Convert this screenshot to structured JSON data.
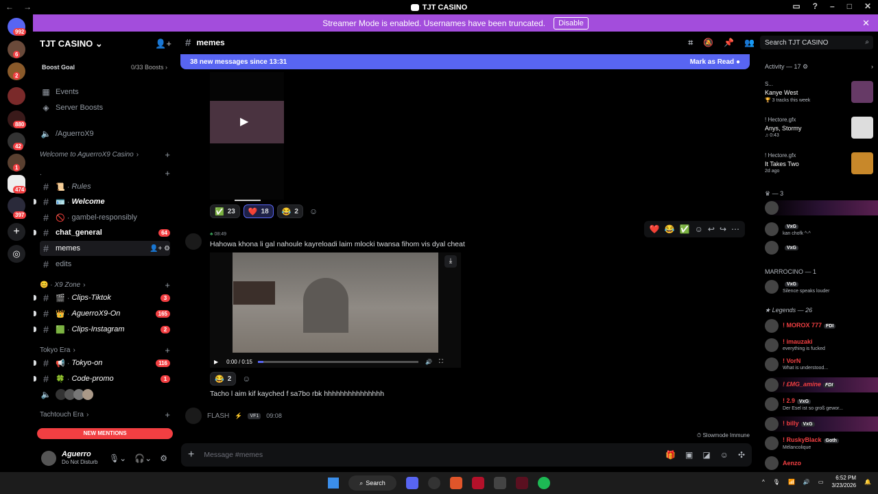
{
  "window": {
    "title": "TJT CASINO"
  },
  "banner": {
    "text": "Streamer Mode is enabled. Usernames have been truncated.",
    "button": "Disable"
  },
  "guild_badges": [
    "992",
    "6",
    "2",
    "880",
    "42",
    "1",
    "474",
    "397"
  ],
  "server": {
    "name": "TJT CASINO",
    "boost_goal": "Boost Goal",
    "boost_count": "0/33 Boosts",
    "items": [
      {
        "type": "nav",
        "icon": "calendar-icon",
        "label": "Events"
      },
      {
        "type": "nav",
        "icon": "boost-icon",
        "label": "Server Boosts"
      },
      {
        "type": "voice",
        "label": "/AguerroX9"
      },
      {
        "type": "category",
        "label": "Welcome to AguerroX9 Casino"
      },
      {
        "type": "category",
        "label": "."
      },
      {
        "type": "channel",
        "label": "Rules",
        "prefix": "📜 ·"
      },
      {
        "type": "channel",
        "label": "Welcome",
        "prefix": "🪪 ·",
        "unread": true
      },
      {
        "type": "channel",
        "label": "gambel-responsibly",
        "prefix": "🚫 ·"
      },
      {
        "type": "channel",
        "label": "chat_general",
        "badge": "64",
        "unread": true
      },
      {
        "type": "channel",
        "label": "memes",
        "active": true
      },
      {
        "type": "channel",
        "label": "edits"
      },
      {
        "type": "category",
        "label": "X9 Zone"
      },
      {
        "type": "channel",
        "label": "Clips-Tiktok",
        "prefix": "🎬 ·",
        "badge": "3",
        "unread": true
      },
      {
        "type": "channel",
        "label": "AguerroX9-On",
        "prefix": "👑 ·",
        "badge": "165",
        "unread": true
      },
      {
        "type": "channel",
        "label": "Clips-Instagram",
        "prefix": "🟩 ·",
        "badge": "2",
        "unread": true
      },
      {
        "type": "category",
        "label": "Tokyo Era"
      },
      {
        "type": "channel",
        "label": "Tokyo-on",
        "prefix": "📢 ·",
        "badge": "116",
        "unread": true
      },
      {
        "type": "channel",
        "label": "Code-promo",
        "prefix": "🍀 ·",
        "badge": "1",
        "unread": true
      },
      {
        "type": "category",
        "label": "Tachtouch Era"
      }
    ],
    "new_mentions": "NEW MENTIONS"
  },
  "user": {
    "name": "Aguerro",
    "status": "Do Not Disturb"
  },
  "chat": {
    "channel": "memes",
    "new_messages": "38 new messages since 13:31",
    "mark_read": "Mark as Read",
    "reactions1": [
      {
        "emoji": "✅",
        "count": "23"
      },
      {
        "emoji": "❤️",
        "count": "18",
        "mine": true
      },
      {
        "emoji": "😂",
        "count": "2"
      }
    ],
    "msg2_time": "08:49",
    "msg2_text": "Hahowa khona li gal nahoule kayreloadi laim mlocki  twansa fihom vis dyal cheat",
    "video_time": "0:00 / 0:15",
    "reactions2": [
      {
        "emoji": "😂",
        "count": "2"
      }
    ],
    "msg3_text": "Tacho l aim kif kayched f sa7bo rbk hhhhhhhhhhhhhhh",
    "msg4_name": "FLASH",
    "msg4_tag": "VF1",
    "msg4_time": "09:08",
    "slowmode": "Slowmode Immune",
    "composer_placeholder": "Message #memes"
  },
  "search": {
    "placeholder": "Search TJT CASINO"
  },
  "activity": {
    "header": "Activity — 17",
    "items": [
      {
        "source": "S...",
        "title": "Kanye West",
        "sub": "3 tracks this week"
      },
      {
        "source": "! Hectore.gfx",
        "title": "Anys, Stormy",
        "sub": "0:43"
      },
      {
        "source": "! Hectore.gfx",
        "title": "It Takes Two",
        "sub": "2d ago"
      }
    ]
  },
  "members": {
    "group1": "— 3",
    "g1": [
      {
        "name": "",
        "status": ""
      },
      {
        "name": "",
        "tag": "VxG",
        "status": "kan chofk ^-^"
      },
      {
        "name": "",
        "tag": "VxG",
        "status": ""
      }
    ],
    "group2": "MARROCINO — 1",
    "g2": [
      {
        "name": "",
        "tag": "VxG",
        "status": "Silence speaks louder"
      }
    ],
    "group3": "Legends — 26",
    "g3": [
      {
        "name": "! MOROX 777",
        "tag": "FDI",
        "status": ""
      },
      {
        "name": "! imauzaki",
        "status": "everything is fucked"
      },
      {
        "name": "! VorN",
        "status": "What is understood..."
      },
      {
        "name": "! £MG_amine",
        "tag": "FDI",
        "status": ""
      },
      {
        "name": "! 2.9",
        "tag": "VxG",
        "status": "Der Esel ist so groß gewor..."
      },
      {
        "name": "! billy",
        "tag": "VxG",
        "status": ""
      },
      {
        "name": "! RuskyBlack",
        "tag": "Goth",
        "status": "Mélancolique"
      },
      {
        "name": "Aenzo",
        "status": ""
      }
    ]
  },
  "taskbar": {
    "search": "Search",
    "time": "6:52 PM",
    "date": "3/23/2026"
  }
}
